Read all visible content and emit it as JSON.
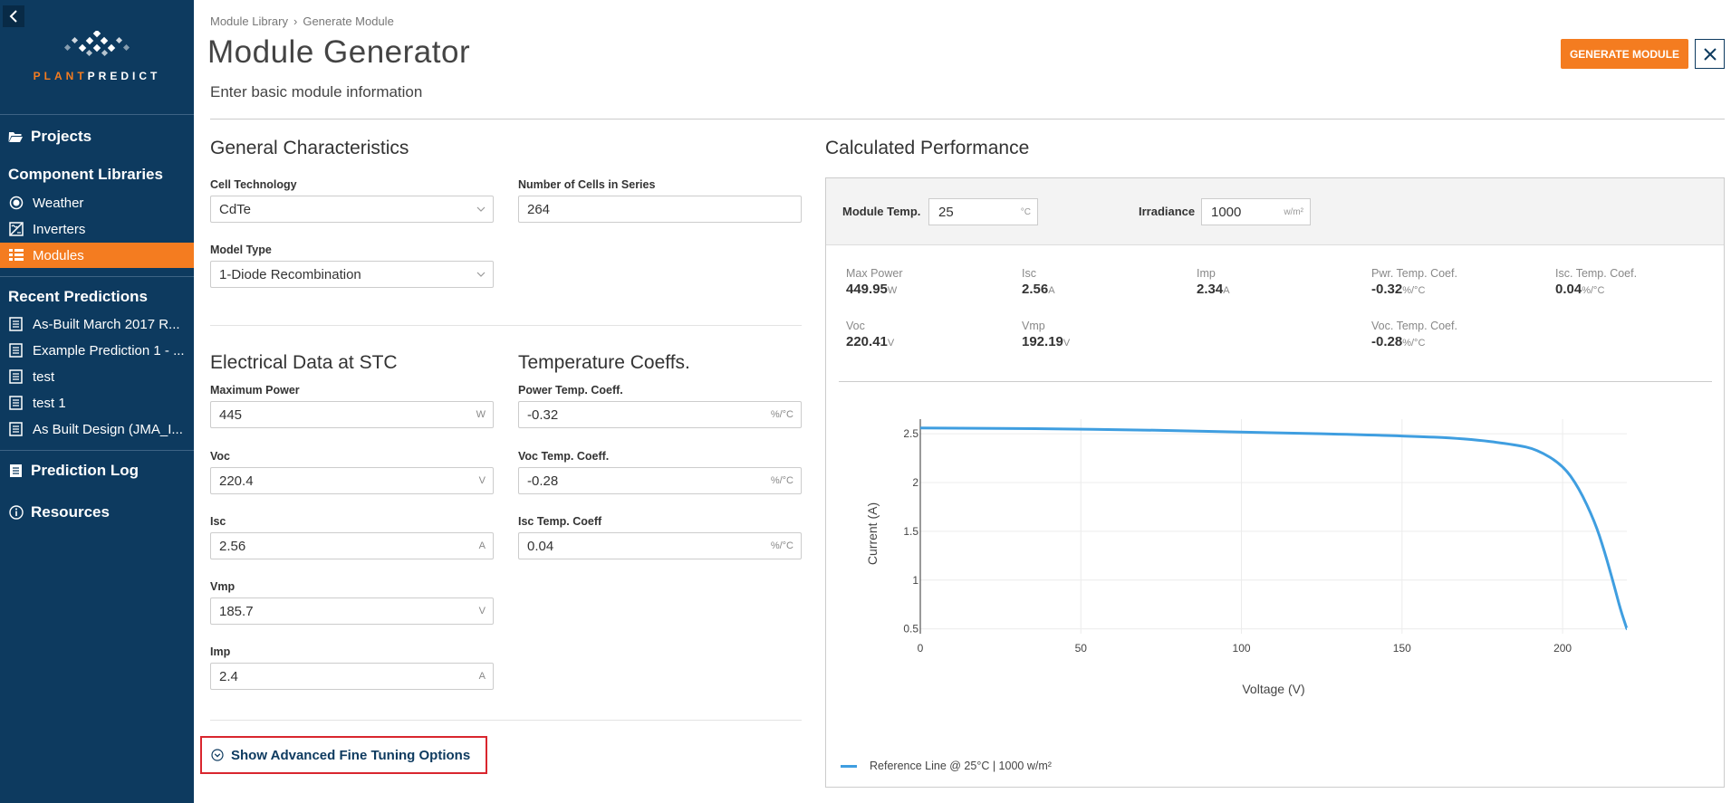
{
  "sidebar": {
    "logo": {
      "part1": "PLANT",
      "part2": "PREDICT"
    },
    "projects": "Projects",
    "component_libraries": "Component Libraries",
    "libraries": [
      {
        "label": "Weather",
        "icon": "weather-icon"
      },
      {
        "label": "Inverters",
        "icon": "inverter-icon"
      },
      {
        "label": "Modules",
        "icon": "modules-icon",
        "active": true
      }
    ],
    "recent_predictions": "Recent Predictions",
    "predictions": [
      "As-Built March 2017 R...",
      "Example Prediction 1 - ...",
      "test",
      "test 1",
      "As Built Design (JMA_I..."
    ],
    "prediction_log": "Prediction Log",
    "resources": "Resources"
  },
  "header": {
    "breadcrumb": [
      "Module Library",
      "Generate Module"
    ],
    "title": "Module Generator",
    "subtitle": "Enter basic module information",
    "generate_label": "GENERATE MODULE"
  },
  "general": {
    "title": "General Characteristics",
    "cell_technology": {
      "label": "Cell Technology",
      "value": "CdTe"
    },
    "num_cells": {
      "label": "Number of Cells in Series",
      "value": "264"
    },
    "model_type": {
      "label": "Model Type",
      "value": "1-Diode Recombination"
    }
  },
  "electrical": {
    "title": "Electrical Data at STC",
    "max_power": {
      "label": "Maximum Power",
      "value": "445",
      "unit": "W"
    },
    "voc": {
      "label": "Voc",
      "value": "220.4",
      "unit": "V"
    },
    "isc": {
      "label": "Isc",
      "value": "2.56",
      "unit": "A"
    },
    "vmp": {
      "label": "Vmp",
      "value": "185.7",
      "unit": "V"
    },
    "imp": {
      "label": "Imp",
      "value": "2.4",
      "unit": "A"
    }
  },
  "temperature": {
    "title": "Temperature Coeffs.",
    "power": {
      "label": "Power Temp. Coeff.",
      "value": "-0.32",
      "unit": "%/°C"
    },
    "voc": {
      "label": "Voc Temp. Coeff.",
      "value": "-0.28",
      "unit": "%/°C"
    },
    "isc": {
      "label": "Isc Temp. Coeff",
      "value": "0.04",
      "unit": "%/°C"
    }
  },
  "advanced_toggle": "Show Advanced Fine Tuning Options",
  "performance": {
    "title": "Calculated Performance",
    "module_temp": {
      "label": "Module Temp.",
      "value": "25",
      "unit": "°C"
    },
    "irradiance": {
      "label": "Irradiance",
      "value": "1000",
      "unit": "w/m²"
    },
    "metrics": {
      "max_power": {
        "label": "Max Power",
        "value": "449.95",
        "unit": "W"
      },
      "isc": {
        "label": "Isc",
        "value": "2.56",
        "unit": "A"
      },
      "imp": {
        "label": "Imp",
        "value": "2.34",
        "unit": "A"
      },
      "pwr_temp": {
        "label": "Pwr. Temp. Coef.",
        "value": "-0.32",
        "unit": "%/°C"
      },
      "isc_temp": {
        "label": "Isc. Temp. Coef.",
        "value": "0.04",
        "unit": "%/°C"
      },
      "voc": {
        "label": "Voc",
        "value": "220.41",
        "unit": "V"
      },
      "vmp": {
        "label": "Vmp",
        "value": "192.19",
        "unit": "V"
      },
      "voc_temp": {
        "label": "Voc. Temp. Coef.",
        "value": "-0.28",
        "unit": "%/°C"
      }
    },
    "legend": "Reference Line @ 25°C | 1000 w/m²"
  },
  "colors": {
    "accent": "#f47c20",
    "sidebar": "#0d3a5f",
    "series": "#3f9ee0",
    "highlight": "#d9262e"
  },
  "chart_data": {
    "type": "line",
    "xlabel": "Voltage (V)",
    "ylabel": "Current (A)",
    "xlim": [
      0,
      220
    ],
    "ylim": [
      0.45,
      2.65
    ],
    "x_ticks": [
      0,
      50,
      100,
      150,
      200
    ],
    "y_ticks": [
      0.5,
      1,
      1.5,
      2,
      2.5
    ],
    "grid": true,
    "legend_position": "bottom-left",
    "series": [
      {
        "name": "Reference Line @ 25°C | 1000 w/m²",
        "x": [
          0,
          50,
          100,
          150,
          170,
          185,
          192,
          200,
          205,
          210,
          213,
          216,
          218,
          220
        ],
        "y": [
          2.56,
          2.55,
          2.52,
          2.48,
          2.45,
          2.39,
          2.34,
          2.18,
          1.95,
          1.6,
          1.3,
          0.95,
          0.7,
          0.5
        ]
      }
    ]
  }
}
